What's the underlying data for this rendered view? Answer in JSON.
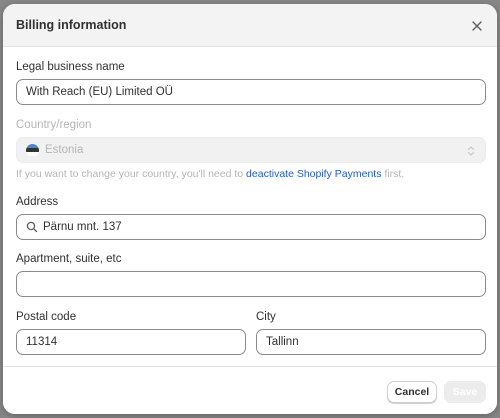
{
  "dialog": {
    "title": "Billing information",
    "close_icon": "close-icon"
  },
  "form": {
    "legal_name": {
      "label": "Legal business name",
      "value": "With Reach (EU) Limited OÜ"
    },
    "country": {
      "label": "Country/region",
      "value": "Estonia",
      "flag_colors": [
        "#2e6fd6",
        "#111111",
        "#ffffff"
      ],
      "disabled": true,
      "help_prefix": "If you want to change your country, you'll need to",
      "help_link": "deactivate Shopify Payments",
      "help_suffix": "first."
    },
    "address": {
      "label": "Address",
      "value": "Pärnu mnt. 137",
      "icon": "search-icon"
    },
    "apartment": {
      "label": "Apartment, suite, etc",
      "value": ""
    },
    "postal_code": {
      "label": "Postal code",
      "value": "11314"
    },
    "city": {
      "label": "City",
      "value": "Tallinn"
    }
  },
  "footer": {
    "cancel_label": "Cancel",
    "save_label": "Save"
  },
  "colors": {
    "link": "#1f5fbf",
    "disabled_text": "#b5b5b5",
    "header_bg": "#f3f3f3"
  }
}
